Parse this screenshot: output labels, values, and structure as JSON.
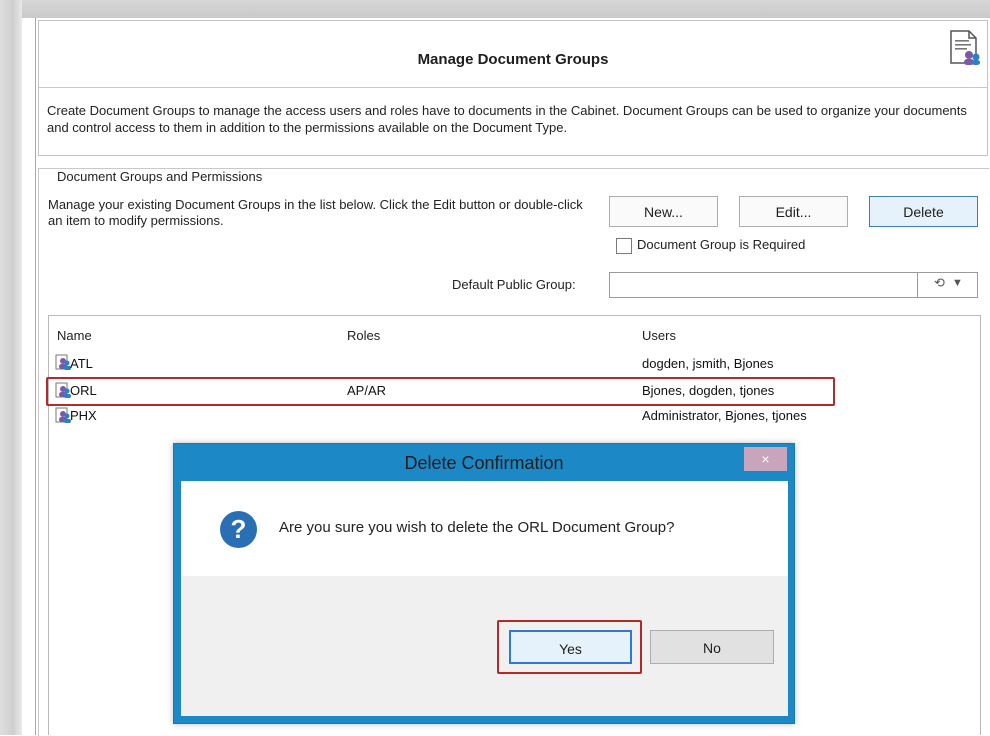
{
  "header": {
    "title": "Manage Document Groups",
    "description": "Create Document Groups to manage the access users and roles have to documents in the Cabinet.  Document Groups can be used to organize your documents and control access to them in addition to the permissions available on the Document Type."
  },
  "groupbox": {
    "legend": "Document Groups and Permissions",
    "instructions": "Manage your existing Document Groups in the list below.  Click the Edit button or double-click an item to modify permissions.",
    "buttons": {
      "new": "New...",
      "edit": "Edit...",
      "delete": "Delete"
    },
    "required_checkbox_label": "Document Group is Required",
    "required_checked": false,
    "default_public_group_label": "Default Public Group:",
    "default_public_group_value": ""
  },
  "list": {
    "columns": [
      "Name",
      "Roles",
      "Users"
    ],
    "rows": [
      {
        "name": "ATL",
        "roles": "",
        "users": "dogden, jsmith, Bjones"
      },
      {
        "name": "ORL",
        "roles": "AP/AR",
        "users": "Bjones, dogden, tjones",
        "highlighted": true
      },
      {
        "name": "PHX",
        "roles": "",
        "users": "Administrator, Bjones, tjones"
      }
    ]
  },
  "dialog": {
    "title": "Delete Confirmation",
    "close_label": "×",
    "message": "Are you sure you wish to delete the ORL Document Group?",
    "icon": "question-icon",
    "yes_label": "Yes",
    "no_label": "No"
  },
  "colors": {
    "dialog_frame": "#1c88c6",
    "highlight_outline": "#b22a2a",
    "selected_button": "#e5f1fb"
  }
}
